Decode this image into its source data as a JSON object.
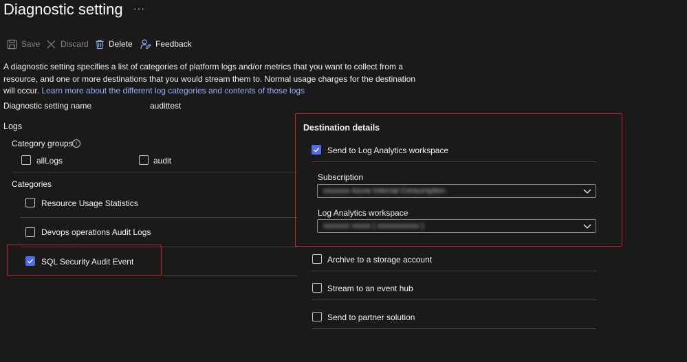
{
  "header": {
    "title": "Diagnostic setting",
    "more": "···"
  },
  "toolbar": {
    "save": "Save",
    "discard": "Discard",
    "delete": "Delete",
    "feedback": "Feedback"
  },
  "description": {
    "text": "A diagnostic setting specifies a list of categories of platform logs and/or metrics that you want to collect from a resource, and one or more destinations that you would stream them to. Normal usage charges for the destination will occur. ",
    "link": "Learn more about the different log categories and contents of those logs"
  },
  "setting_name": {
    "label": "Diagnostic setting name",
    "value": "audittest"
  },
  "logs": {
    "heading": "Logs",
    "category_groups_label": "Category groups",
    "groups": [
      {
        "label": "allLogs",
        "checked": false
      },
      {
        "label": "audit",
        "checked": false
      }
    ],
    "categories_label": "Categories",
    "categories": [
      {
        "label": "Resource Usage Statistics",
        "checked": false
      },
      {
        "label": "Devops operations Audit Logs",
        "checked": false
      },
      {
        "label": "SQL Security Audit Event",
        "checked": true
      }
    ]
  },
  "destination": {
    "heading": "Destination details",
    "log_analytics": {
      "label": "Send to Log Analytics workspace",
      "checked": true
    },
    "subscription_label": "Subscription",
    "subscription_value": "xxxxxxx Azure Internal Consumption",
    "workspace_label": "Log Analytics workspace",
    "workspace_value": "xxxxxxx xxxxx ( xxxxxxxxxxx )",
    "options": [
      {
        "label": "Archive to a storage account",
        "checked": false
      },
      {
        "label": "Stream to an event hub",
        "checked": false
      },
      {
        "label": "Send to partner solution",
        "checked": false
      }
    ]
  },
  "colors": {
    "accent": "#4f6bed",
    "highlight": "#c4262e",
    "link": "#8ab4f8",
    "background": "#1b1a19"
  }
}
